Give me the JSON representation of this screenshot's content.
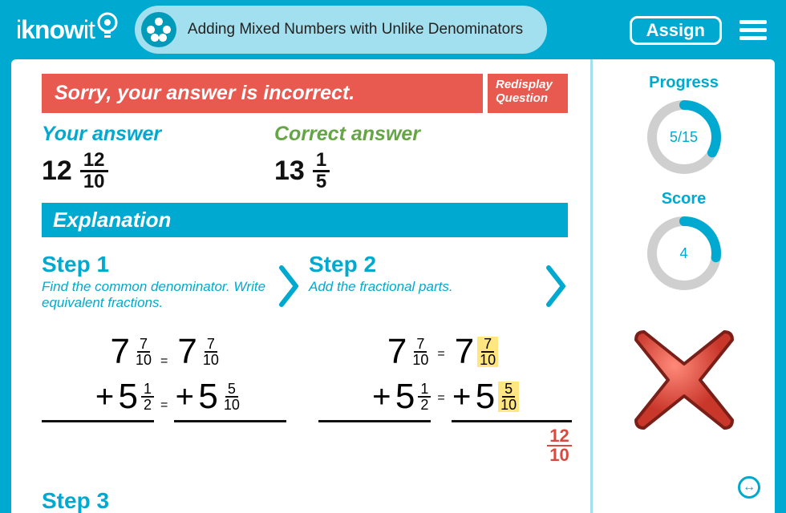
{
  "header": {
    "logo_prefix": "i",
    "logo_bold": "know",
    "logo_suffix": "it",
    "title": "Adding Mixed Numbers with Unlike Denominators",
    "assign": "Assign"
  },
  "banner": {
    "message": "Sorry, your answer is incorrect.",
    "redisplay_l1": "Redisplay",
    "redisplay_l2": "Question"
  },
  "your_answer_label": "Your answer",
  "correct_answer_label": "Correct answer",
  "your_answer": {
    "whole": "12",
    "num": "12",
    "den": "10"
  },
  "correct_answer": {
    "whole": "13",
    "num": "1",
    "den": "5"
  },
  "explanation_label": "Explanation",
  "steps": {
    "s1_title": "Step 1",
    "s1_sub": "Find the common denominator. Write equivalent fractions.",
    "s2_title": "Step 2",
    "s2_sub": "Add the fractional parts.",
    "s3_title": "Step 3"
  },
  "eq": {
    "a_whole": "7",
    "a_num": "7",
    "a_den": "10",
    "a2_num": "7",
    "a2_den": "10",
    "b_whole": "5",
    "b_num": "1",
    "b_den": "2",
    "b2_num": "5",
    "b2_den": "10",
    "sum_num": "12",
    "sum_den": "10",
    "plus": "+",
    "equals": "="
  },
  "sidebar": {
    "progress_label": "Progress",
    "progress_text": "5/15",
    "progress_pct": 33,
    "score_label": "Score",
    "score_text": "4",
    "score_pct": 27
  },
  "colors": {
    "brand": "#00a9cf",
    "error": "#e85a4f",
    "ok": "#66a546",
    "highlight": "#ffe680"
  }
}
